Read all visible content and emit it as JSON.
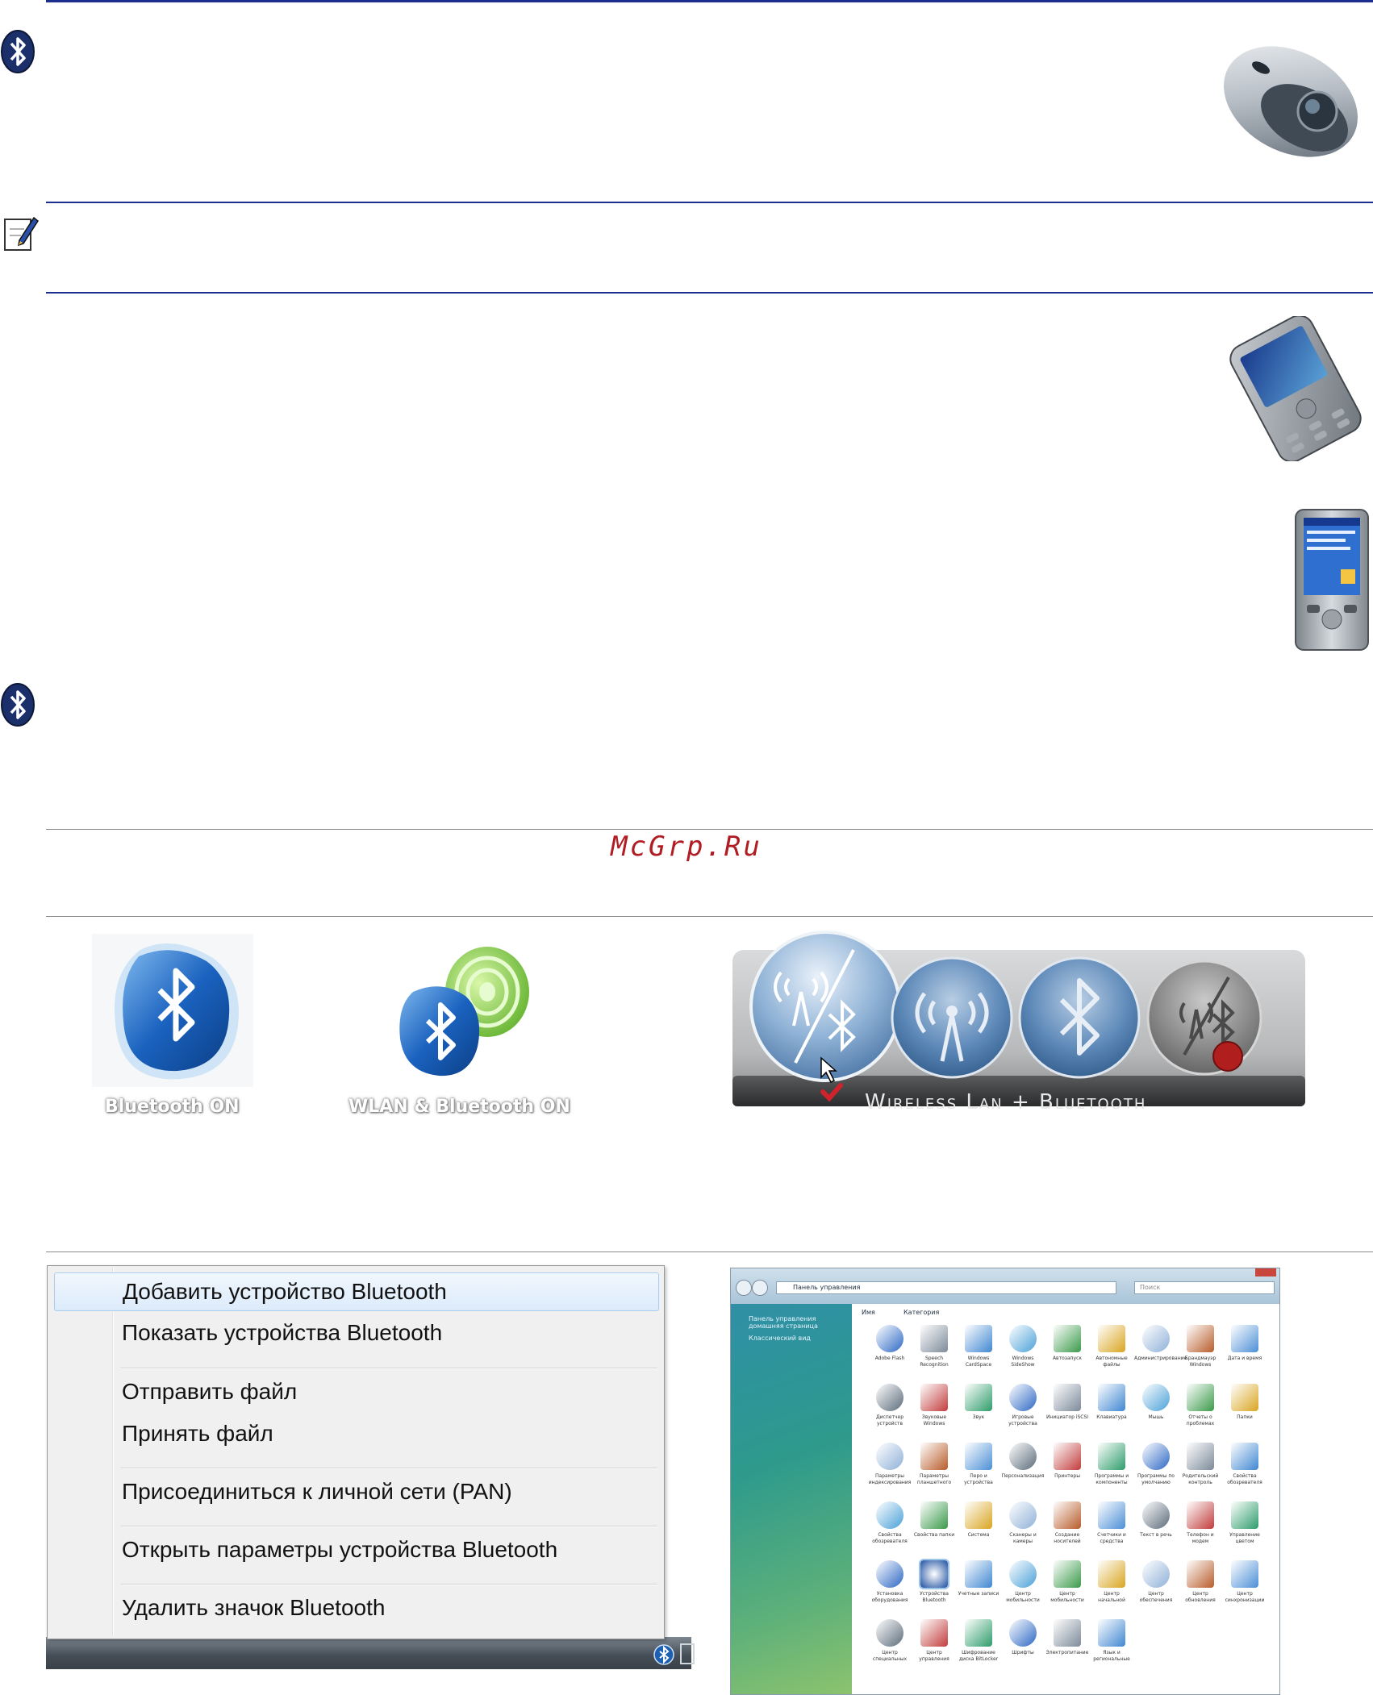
{
  "watermark": "McGrp.Ru",
  "osd_left": {
    "bluetooth_on_label": "Bluetooth ON",
    "wlan_bluetooth_on_label": "WLAN & Bluetooth ON"
  },
  "osd_right": {
    "label": "Wireless Lan + Bluetooth"
  },
  "context_menu": {
    "items": [
      "Добавить устройство Bluetooth",
      "Показать устройства Bluetooth",
      "Отправить файл",
      "Принять файл",
      "Присоединиться к личной сети (PAN)",
      "Открыть параметры устройства Bluetooth",
      "Удалить значок Bluetooth"
    ]
  },
  "control_panel": {
    "address": "Панель управления",
    "search_placeholder": "Поиск",
    "sidebar": [
      "Панель управления домашняя страница",
      "Классический вид"
    ],
    "columns": [
      "Имя",
      "Категория"
    ],
    "icons": [
      "Adobe Flash",
      "Speech Recognition",
      "Windows CardSpace",
      "Windows SideShow",
      "Автозапуск",
      "Автономные файлы",
      "Администрирование",
      "Брандмауэр Windows",
      "Дата и время",
      "Диспетчер устройств",
      "Звуковые Windows",
      "Звук",
      "Игровые устройства",
      "Инициатор iSCSI",
      "Клавиатура",
      "Мышь",
      "Отчеты о проблемах",
      "Папки",
      "Параметры индексирования",
      "Параметры планшетного",
      "Перо и устройства",
      "Персонализация",
      "Принтеры",
      "Программы и компоненты",
      "Программы по умолчанию",
      "Родительский контроль",
      "Свойства обозревателя",
      "Свойства обозревателя",
      "Свойства папки",
      "Система",
      "Сканеры и камеры",
      "Создание носителей",
      "Счетчики и средства",
      "Текст в речь",
      "Телефон и модем",
      "Управление цветом",
      "Установка оборудования",
      "Устройства Bluetooth",
      "Учетные записи",
      "Центр мобильности",
      "Центр мобильности",
      "Центр начальной",
      "Центр обеспечения",
      "Центр обновления",
      "Центр синхронизации",
      "Центр специальных",
      "Центр управления",
      "Шифрование диска BitLocker",
      "Шрифты",
      "Электропитание",
      "Язык и региональные"
    ]
  }
}
